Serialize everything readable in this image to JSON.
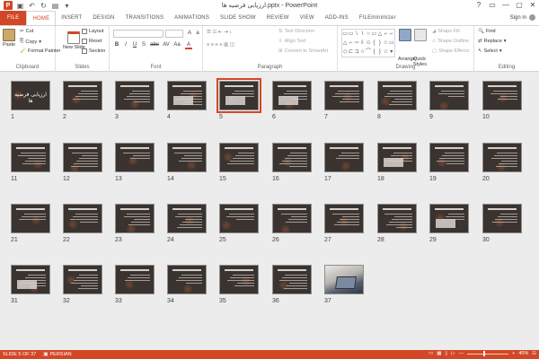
{
  "window": {
    "title": "ارزیابی فرضیه ها.pptx - PowerPoint",
    "controls": [
      "?",
      "▭",
      "—",
      "▢",
      "✕"
    ]
  },
  "tabs": [
    "FILE",
    "HOME",
    "INSERT",
    "DESIGN",
    "TRANSITIONS",
    "ANIMATIONS",
    "SLIDE SHOW",
    "REVIEW",
    "VIEW",
    "ADD-INS",
    "FILEminimizer"
  ],
  "active_tab": "HOME",
  "signin": "Sign in",
  "ribbon": {
    "clipboard": {
      "paste": "Paste",
      "cut": "Cut",
      "copy": "Copy",
      "format_painter": "Format Painter",
      "label": "Clipboard"
    },
    "slides": {
      "new_slide": "New Slide",
      "layout": "Layout",
      "reset": "Reset",
      "section": "Section",
      "label": "Slides"
    },
    "font": {
      "label": "Font",
      "buttons": [
        "B",
        "I",
        "U",
        "S",
        "abc",
        "AV",
        "Aa",
        "A"
      ]
    },
    "paragraph": {
      "text_direction": "Text Direction",
      "align_text": "Align Text",
      "convert": "Convert to SmartArt",
      "label": "Paragraph"
    },
    "drawing": {
      "arrange": "Arrange",
      "quick_styles": "Quick Styles",
      "shape_fill": "Shape Fill",
      "shape_outline": "Shape Outline",
      "shape_effects": "Shape Effects",
      "label": "Drawing",
      "shapes": [
        "▭",
        "▭",
        "\\",
        "\\",
        "○",
        "▭",
        "△",
        "⌐",
        "⌐",
        "△",
        "⌐",
        "⇨",
        "⇩",
        "✩",
        "{",
        "}",
        "☆",
        "▭",
        "◇",
        "⊏",
        "⊐",
        "☆",
        "⌒",
        "{",
        "}",
        "☆",
        "▾"
      ]
    },
    "editing": {
      "find": "Find",
      "replace": "Replace",
      "select": "Select",
      "label": "Editing"
    }
  },
  "slides": [
    "1",
    "2",
    "3",
    "4",
    "5",
    "6",
    "7",
    "8",
    "9",
    "10",
    "11",
    "12",
    "13",
    "14",
    "15",
    "16",
    "17",
    "18",
    "19",
    "20",
    "21",
    "22",
    "23",
    "24",
    "25",
    "26",
    "27",
    "28",
    "29",
    "30",
    "31",
    "32",
    "33",
    "34",
    "35",
    "36",
    "37"
  ],
  "selected_slide": "5",
  "first_slide_title": "ارزیابی فرضیه ها",
  "status": {
    "slide": "SLIDE 5 OF 37",
    "language": "PERSIAN",
    "zoom": "40%",
    "zoom_fraction": 0.4
  },
  "colors": {
    "accent": "#d24726",
    "slide_bg": "#3a3330"
  }
}
